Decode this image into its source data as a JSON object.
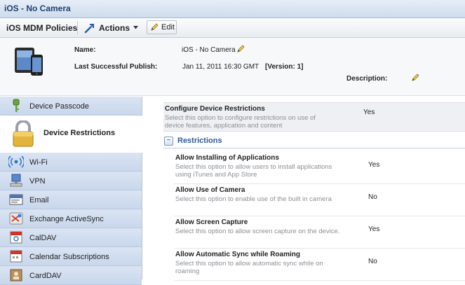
{
  "window": {
    "title": "iOS - No Camera"
  },
  "toolbar": {
    "policies_label": "iOS MDM Policies",
    "actions_label": "Actions",
    "edit_label": "Edit"
  },
  "info": {
    "name_label": "Name:",
    "name_value": "iOS - No Camera",
    "publish_label": "Last Successful Publish:",
    "publish_value": "Jan 11, 2011 16:30 GMT",
    "version_value": "[Version: 1]",
    "description_label": "Description:"
  },
  "sidebar": {
    "items": [
      {
        "label": "Device Passcode",
        "icon": "key-icon"
      },
      {
        "label": "Device Restrictions",
        "icon": "padlock-icon"
      },
      {
        "label": "Wi-Fi",
        "icon": "wifi-icon"
      },
      {
        "label": "VPN",
        "icon": "vpn-icon"
      },
      {
        "label": "Email",
        "icon": "email-icon"
      },
      {
        "label": "Exchange ActiveSync",
        "icon": "exchange-icon"
      },
      {
        "label": "CalDAV",
        "icon": "caldav-icon"
      },
      {
        "label": "Calendar Subscriptions",
        "icon": "calendar-icon"
      },
      {
        "label": "CardDAV",
        "icon": "carddav-icon"
      }
    ]
  },
  "main": {
    "configure": {
      "title": "Configure Device Restrictions",
      "description": "Select this option to configure restrictions on use of device features, application and content",
      "value": "Yes"
    },
    "section_title": "Restrictions",
    "rows": [
      {
        "title": "Allow Installing of Applications",
        "description": "Select this option to allow users to install applications using iTunes and App Store",
        "value": "Yes"
      },
      {
        "title": "Allow Use of Camera",
        "description": "Select this option to enable use of the built in camera",
        "value": "No"
      },
      {
        "title": "Allow Screen Capture",
        "description": "Select this option to allow screen capture on the device.",
        "value": "Yes"
      },
      {
        "title": "Allow Automatic Sync while Roaming",
        "description": "Select this option to allow automatic sync while on roaming",
        "value": "No"
      }
    ]
  },
  "colors": {
    "accent": "#2d5aa0",
    "sidebar_bg": "#cfdbee",
    "title_text": "#203f73"
  }
}
